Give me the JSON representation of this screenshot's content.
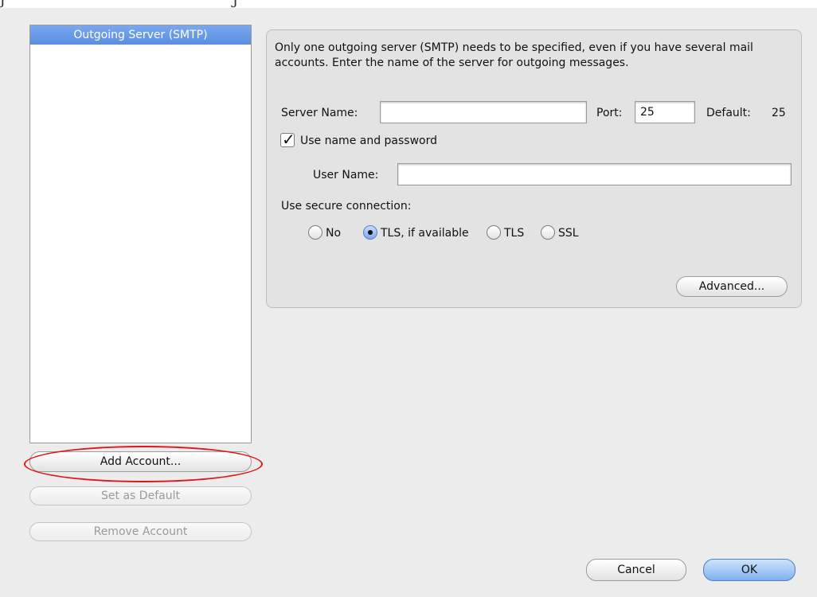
{
  "top_clip_text": "j                                             j",
  "accounts": {
    "items": [
      {
        "label": "Outgoing Server (SMTP)"
      }
    ]
  },
  "buttons": {
    "add_account": "Add Account...",
    "set_default": "Set as Default",
    "remove_account": "Remove Account",
    "advanced": "Advanced...",
    "cancel": "Cancel",
    "ok": "OK"
  },
  "smtp": {
    "description": "Only one outgoing server (SMTP) needs to be specified, even if you have several mail accounts. Enter the name of the server for outgoing messages.",
    "server_name_label": "Server Name:",
    "server_name_value": "",
    "port_label": "Port:",
    "port_value": "25",
    "default_label": "Default:",
    "default_value": "25",
    "use_auth_label": "Use name and password",
    "use_auth_checked": true,
    "user_name_label": "User Name:",
    "user_name_value": "",
    "secure_label": "Use secure connection:",
    "secure_options": [
      {
        "label": "No",
        "selected": false
      },
      {
        "label": "TLS, if available",
        "selected": true
      },
      {
        "label": "TLS",
        "selected": false
      },
      {
        "label": "SSL",
        "selected": false
      }
    ]
  },
  "annotation_color": "#e0141a"
}
